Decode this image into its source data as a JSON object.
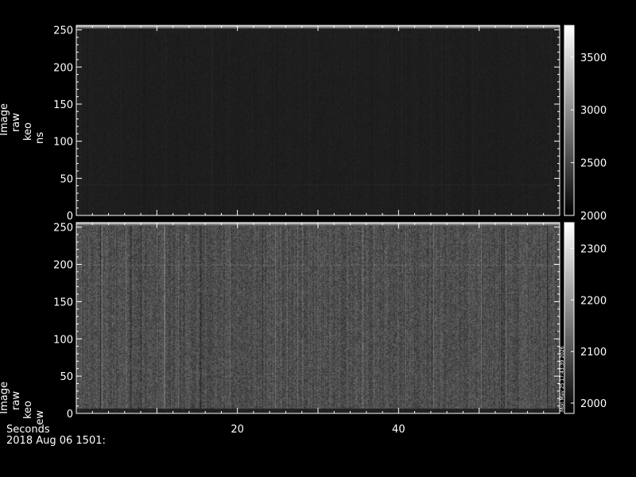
{
  "chart_data": [
    {
      "type": "heatmap",
      "title": "",
      "ylabel_lines": [
        "Image",
        "raw",
        "keo",
        "ns"
      ],
      "ylim": [
        0,
        256
      ],
      "xlim": [
        0,
        60
      ],
      "yticks": [
        "0",
        "50",
        "100",
        "150",
        "200",
        "250"
      ],
      "ytick_values": [
        0,
        50,
        100,
        150,
        200,
        250
      ],
      "colorbar": {
        "range": [
          2000,
          3800
        ],
        "ticks": [
          "2000",
          "2500",
          "3000",
          "3500"
        ],
        "tick_values": [
          2000,
          2500,
          3000,
          3500
        ]
      },
      "appearance": {
        "base_gray": 30,
        "noise_amp": 5,
        "stripe_amp": 3,
        "bright_top_rows": true,
        "faint_line_at_y": 42,
        "dark_bottom_band": false
      }
    },
    {
      "type": "heatmap",
      "title": "",
      "ylabel_lines": [
        "Image",
        "raw",
        "keo",
        "ew"
      ],
      "ylim": [
        0,
        256
      ],
      "xlim": [
        0,
        60
      ],
      "yticks": [
        "0",
        "50",
        "100",
        "150",
        "200",
        "250"
      ],
      "ytick_values": [
        0,
        50,
        100,
        150,
        200,
        250
      ],
      "colorbar": {
        "range": [
          1980,
          2350
        ],
        "ticks": [
          "2000",
          "2100",
          "2200",
          "2300"
        ],
        "tick_values": [
          2000,
          2100,
          2200,
          2300
        ],
        "side_label": "Mon May 25 17:43:39 2026"
      },
      "appearance": {
        "base_gray": 78,
        "noise_amp": 26,
        "stripe_amp": 20,
        "bright_top_rows": true,
        "faint_line_at_y": 200,
        "dark_bottom_band": true
      }
    }
  ],
  "x_axis": {
    "label": "Seconds",
    "ticks": [
      "20",
      "40"
    ],
    "tick_values": [
      20,
      40
    ],
    "minor_step": 2
  },
  "footer": {
    "date_label": "2018 Aug 06 1501:"
  }
}
